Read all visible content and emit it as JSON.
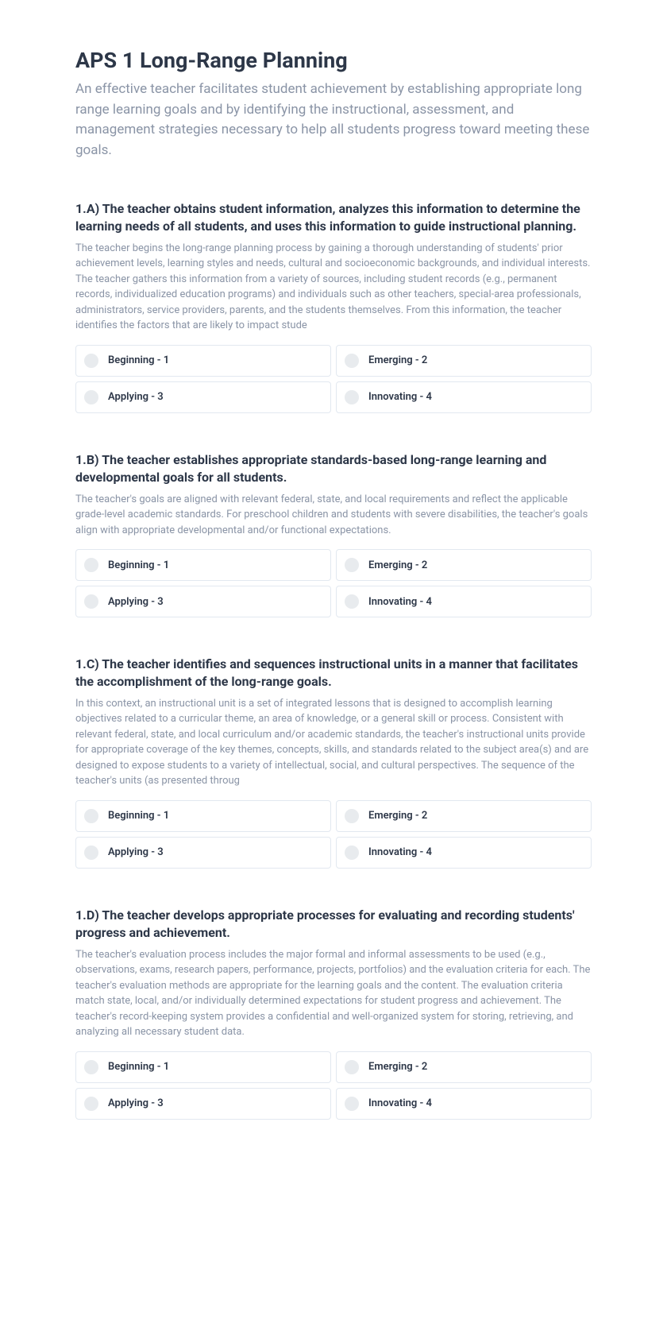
{
  "page": {
    "title": "APS 1 Long-Range Planning",
    "description": "An effective teacher facilitates student achievement by establishing appropriate long range learning goals and by identifying the instructional, assessment, and management strategies necessary to help all students progress toward meeting these goals."
  },
  "ratingOptions": {
    "beginning": "Beginning - 1",
    "emerging": "Emerging - 2",
    "applying": "Applying - 3",
    "innovating": "Innovating - 4"
  },
  "sections": [
    {
      "title": "1.A) The teacher obtains student information, analyzes this information to determine the learning needs of all students, and uses this information to guide instructional planning.",
      "description": "The teacher begins the long-range planning process by gaining a thorough understanding of students' prior achievement levels, learning styles and needs, cultural and socioeconomic backgrounds, and individual interests. The teacher gathers this information from a variety of sources, including student records (e.g., permanent records, individualized education programs) and individuals such as other teachers, special-area professionals, administrators, service providers, parents, and the students themselves. From this information, the teacher identifies the factors that are likely to impact stude"
    },
    {
      "title": "1.B) The teacher establishes appropriate standards-based long-range learning and developmental goals for all students.",
      "description": "The teacher's goals are aligned with relevant federal, state, and local requirements and reflect the applicable grade-level academic standards. For preschool children and students with severe disabilities, the teacher's goals align with appropriate developmental and/or functional expectations."
    },
    {
      "title": "1.C) The teacher identifies and sequences instructional units in a manner that facilitates the accomplishment of the long-range goals.",
      "description": "In this context, an instructional unit is a set of integrated lessons that is designed to accomplish learning objectives related to a curricular theme, an area of knowledge, or a general skill or process. Consistent with relevant federal, state, and local curriculum and/or academic standards, the teacher's instructional units provide for appropriate coverage of the key themes, concepts, skills, and standards related to the subject area(s) and are designed to expose students to a variety of intellectual, social, and cultural perspectives. The sequence of the teacher's units (as presented throug"
    },
    {
      "title": "1.D) The teacher develops appropriate processes for evaluating and recording students' progress and achievement.",
      "description": "The teacher's evaluation process includes the major formal and informal assessments to be used (e.g., observations, exams, research papers, performance, projects, portfolios) and the evaluation criteria for each. The teacher's evaluation methods are appropriate for the learning goals and the content. The evaluation criteria match state, local, and/or individually determined expectations for student progress and achievement. The teacher's record-keeping system provides a confidential and well-organized system for storing, retrieving, and analyzing all necessary student data."
    }
  ]
}
